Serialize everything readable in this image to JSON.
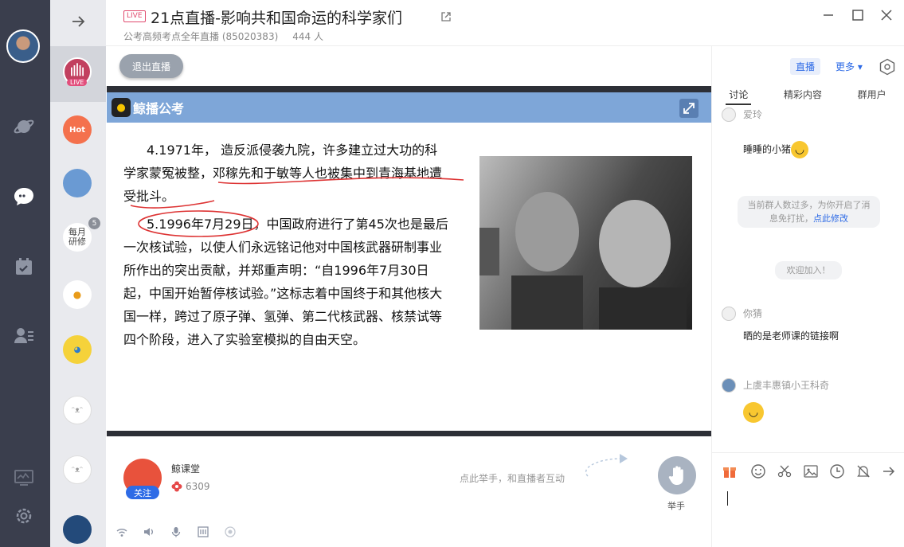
{
  "window": {
    "live_tag": "LIVE",
    "title": "21点直播-影响共和国命运的科学家们",
    "course": "公考高频考点全年直播 (85020383)",
    "viewers": "444 人"
  },
  "groups": {
    "live_label": "LIVE",
    "hot_label": "Hot",
    "monthly_label": "每月\n研修",
    "monthly_badge": "5"
  },
  "toolbar": {
    "exit_label": "退出直播",
    "live_label": "直播",
    "more_label": "更多"
  },
  "tabs": [
    "讨论",
    "精彩内容",
    "群用户"
  ],
  "slide": {
    "brand": "鲸播公考",
    "paragraph1": "4.1971年， 造反派侵袭九院，许多建立过大功的科学家蒙冤被整，邓稼先和于敏等人也被集中到青海基地遭受批斗。",
    "paragraph2": "5.1996年7月29日，中国政府进行了第45次也是最后一次核试验，以使人们永远铭记他对中国核武器研制事业所作出的突出贡献，并郑重声明：“自1996年7月30日起，中国开始暂停核试验。”这标志着中国终于和其他核大国一样，跨过了原子弹、氢弹、第二代核武器、核禁试等四个阶段，进入了实验室模拟的自由天空。"
  },
  "host": {
    "name": "鲸课堂",
    "likes": "6309",
    "follow_label": "关注",
    "raise_hint": "点此举手，和直播者互动",
    "raise_label": "举手"
  },
  "chat": [
    {
      "name": "爱玲",
      "text": "睡睡的小猪"
    },
    {
      "system": "当前群人数过多，为你开启了消息免打扰，",
      "link": "点此修改"
    },
    {
      "system": "欢迎加入！"
    },
    {
      "name": "你猜",
      "text": "晒的是老师课的链接啊"
    },
    {
      "name": "上虞丰惠镇小王科奇",
      "text": ""
    }
  ]
}
